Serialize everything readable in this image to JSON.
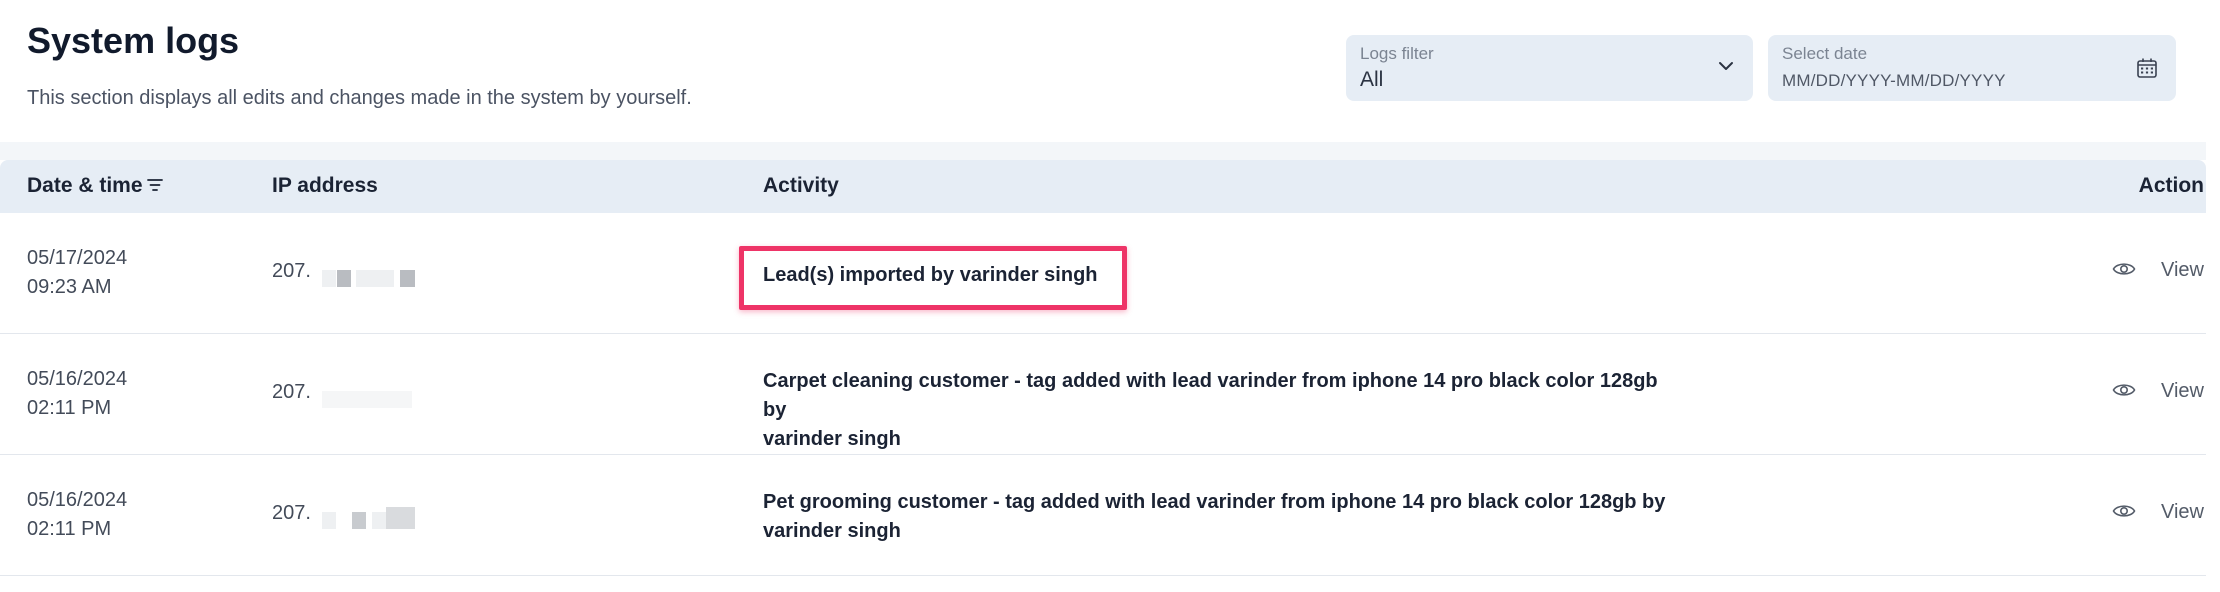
{
  "header": {
    "title": "System logs",
    "subtitle": "This section displays all edits and changes made in the system by yourself."
  },
  "filters": {
    "logs_filter": {
      "label": "Logs filter",
      "value": "All"
    },
    "date": {
      "label": "Select date",
      "placeholder": "MM/DD/YYYY-MM/DD/YYYY"
    }
  },
  "table": {
    "columns": {
      "date": "Date & time",
      "ip": "IP address",
      "activity": "Activity",
      "action": "Action"
    },
    "rows": [
      {
        "date": "05/17/2024",
        "time": "09:23 AM",
        "ip": "207.",
        "activity_line1": "Lead(s) imported by varinder singh",
        "activity_line2": "",
        "action": "View"
      },
      {
        "date": "05/16/2024",
        "time": "02:11 PM",
        "ip": "207.",
        "activity_line1": "Carpet cleaning customer - tag added with lead varinder from iphone 14 pro black color 128gb by",
        "activity_line2": "varinder singh",
        "action": "View"
      },
      {
        "date": "05/16/2024",
        "time": "02:11 PM",
        "ip": "207.",
        "activity_line1": "Pet grooming customer - tag added with lead varinder from iphone 14 pro black color 128gb by",
        "activity_line2": "varinder singh",
        "action": "View"
      }
    ]
  },
  "highlight_color": "#ee3467"
}
